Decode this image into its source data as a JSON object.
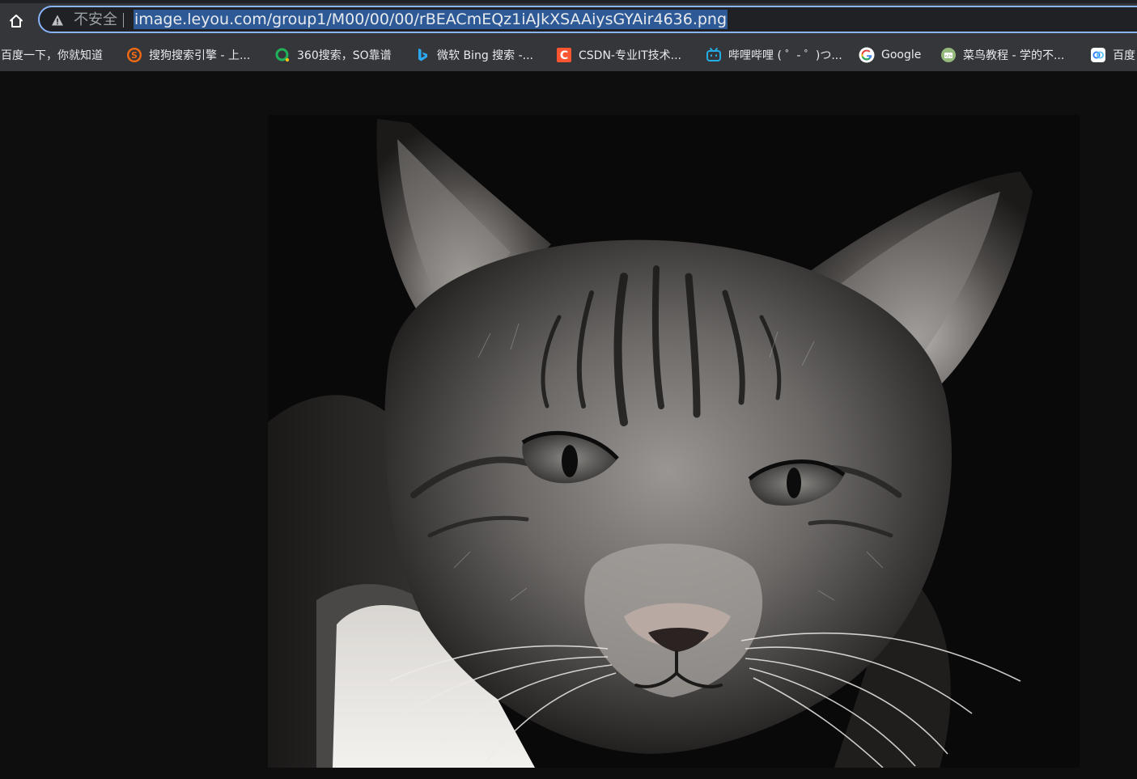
{
  "toolbar": {
    "home_icon": "home-icon",
    "security_icon": "warning-triangle-icon",
    "security_label": "不安全",
    "url": "image.leyou.com/group1/M00/00/00/rBEACmEQz1iAJkXSAAiysGYAir4636.png",
    "colors": {
      "toolbar_bg": "#35363a",
      "omnibox_bg": "#202124",
      "focus_ring": "#8ab4f8",
      "selection": "#2d5a97"
    }
  },
  "bookmarks": [
    {
      "label": "百度一下，你就知道",
      "icon": ""
    },
    {
      "label": "搜狗搜索引擎 - 上...",
      "icon": "sogou-icon"
    },
    {
      "label": "360搜索，SO靠谱",
      "icon": "so360-icon"
    },
    {
      "label": "微软 Bing 搜索 -...",
      "icon": "bing-icon"
    },
    {
      "label": "CSDN-专业IT技术...",
      "icon": "csdn-icon"
    },
    {
      "label": "哔哩哔哩 ( ゜- ゜)つ...",
      "icon": "bilibili-icon"
    },
    {
      "label": "Google",
      "icon": "google-icon"
    },
    {
      "label": "菜鸟教程 - 学的不...",
      "icon": "runoob-icon"
    },
    {
      "label": "百度",
      "icon": "baidu-cloud-icon"
    }
  ],
  "content": {
    "image_subject": "black-and-white tabby cat portrait",
    "page_bg": "#0e0e0e"
  }
}
